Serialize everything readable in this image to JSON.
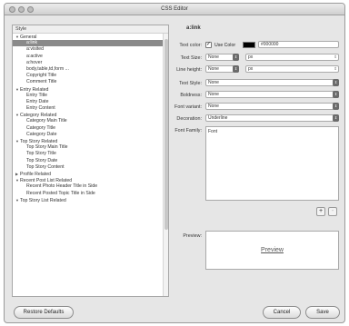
{
  "window": {
    "title": "CSS Editor"
  },
  "list": {
    "header": "Style",
    "items": [
      {
        "label": "General",
        "indent": 0,
        "expand": "down"
      },
      {
        "label": "a:link",
        "indent": 2,
        "selected": true
      },
      {
        "label": "a:visited",
        "indent": 2
      },
      {
        "label": "a:active",
        "indent": 2
      },
      {
        "label": "a:hover",
        "indent": 2
      },
      {
        "label": "body,table,td,form ...",
        "indent": 2
      },
      {
        "label": "Copyright Title",
        "indent": 2
      },
      {
        "label": "Comment Title",
        "indent": 2
      },
      {
        "label": "Entry Related",
        "indent": 0,
        "expand": "down"
      },
      {
        "label": "Entry Title",
        "indent": 2
      },
      {
        "label": "Entry Date",
        "indent": 2
      },
      {
        "label": "Entry Content",
        "indent": 2
      },
      {
        "label": "Category Related",
        "indent": 0,
        "expand": "down"
      },
      {
        "label": "Category Main Title",
        "indent": 2
      },
      {
        "label": "Category Title",
        "indent": 2
      },
      {
        "label": "Category Date",
        "indent": 2
      },
      {
        "label": "Top Story Related",
        "indent": 0,
        "expand": "down"
      },
      {
        "label": "Top Story Main Title",
        "indent": 2
      },
      {
        "label": "Top Story Title",
        "indent": 2
      },
      {
        "label": "Top Story Date",
        "indent": 2
      },
      {
        "label": "Top Story Content",
        "indent": 2
      },
      {
        "label": "Profile Related",
        "indent": 0,
        "expand": "right"
      },
      {
        "label": "Recent Post List Related",
        "indent": 0,
        "expand": "down"
      },
      {
        "label": "Recent Photo Header Title in Side",
        "indent": 2
      },
      {
        "label": "Recent Posted Topic Title in Side",
        "indent": 2
      },
      {
        "label": "Top Story List Related",
        "indent": 0,
        "expand": "down"
      }
    ]
  },
  "editor": {
    "element_name": "a:link",
    "text_color_label": "Text color:",
    "use_color_label": "Use Color",
    "color_hex": "#000000",
    "text_size_label": "Text Size:",
    "text_size_value": "None",
    "text_size_unit": "px",
    "line_height_label": "Line height:",
    "line_height_value": "None",
    "line_height_unit": "px",
    "text_style_label": "Text Style:",
    "text_style_value": "None",
    "boldness_label": "Boldness:",
    "boldness_value": "None",
    "font_variant_label": "Font variant:",
    "font_variant_value": "None",
    "decoration_label": "Decoration:",
    "decoration_value": "Underline",
    "font_family_label": "Font Family:",
    "font_family_value": "Font",
    "add_label": "+",
    "remove_label": "-",
    "preview_label": "Preview:",
    "preview_text": "Preview"
  },
  "footer": {
    "restore_label": "Restore Defaults",
    "cancel_label": "Cancel",
    "save_label": "Save"
  }
}
